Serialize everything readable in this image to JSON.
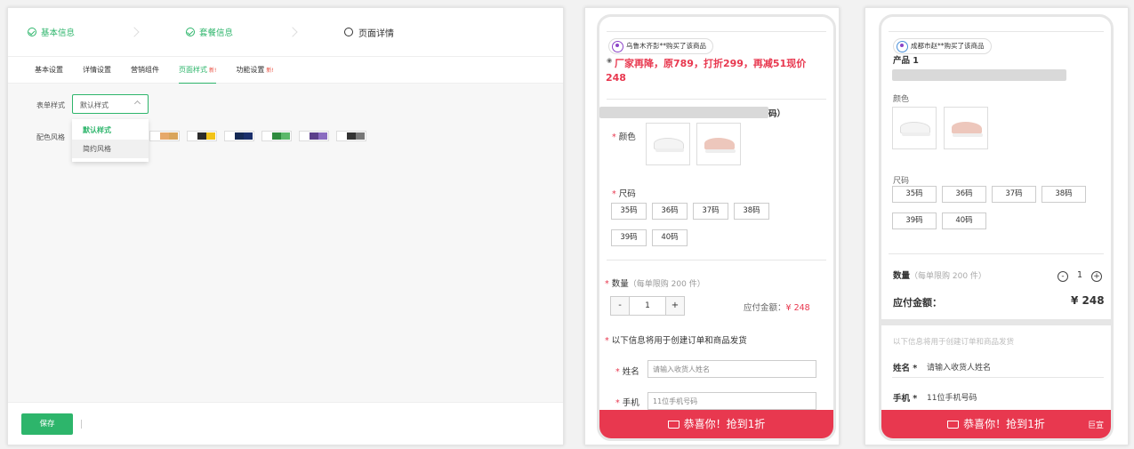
{
  "editor": {
    "steps": [
      {
        "label": "基本信息"
      },
      {
        "label": "套餐信息"
      },
      {
        "label": "页面详情"
      }
    ],
    "tabs": [
      {
        "label": "基本设置"
      },
      {
        "label": "详情设置"
      },
      {
        "label": "营销组件"
      },
      {
        "label": "页面样式",
        "badge": "新!"
      },
      {
        "label": "功能设置",
        "badge": "新!"
      }
    ],
    "form_style_label": "表单样式",
    "form_style_value": "默认样式",
    "form_style_options": [
      "默认样式",
      "简约风格"
    ],
    "color_label": "配色风格",
    "color_swatches": [
      [
        "#ffffff",
        "#e6a86a",
        "#d9a55c"
      ],
      [
        "#ffffff",
        "#2b2b2b",
        "#f2c318"
      ],
      [
        "#ffffff",
        "#152a55",
        "#1a2f6b"
      ],
      [
        "#ffffff",
        "#2e8b3e",
        "#5cb86a"
      ],
      [
        "#ffffff",
        "#5b3f8a",
        "#8a6cc0"
      ],
      [
        "#ffffff",
        "#333333",
        "#777777"
      ]
    ],
    "save_label": "保存",
    "accent": "#2db56b"
  },
  "phone1": {
    "toast": "乌鲁木齐彭**购买了该商品",
    "promo_line1": "厂家再降，原789，打折299，再减51现价",
    "promo_line2": "248",
    "title_tail": "码）",
    "color_label": "颜色",
    "size_label": "尺码",
    "sizes": [
      "35码",
      "36码",
      "37码",
      "38码",
      "39码",
      "40码"
    ],
    "qty_label": "数量",
    "qty_hint": "（每单限购 200 件）",
    "qty_minus": "-",
    "qty_value": "1",
    "qty_plus": "+",
    "pay_label": "应付金额：",
    "pay_value": "¥ 248",
    "info_note": "以下信息将用于创建订单和商品发货",
    "name_label": "姓名",
    "name_placeholder": "请输入收货人姓名",
    "phone_label": "手机",
    "phone_placeholder": "11位手机号码",
    "cta": "恭喜你！抢到1折"
  },
  "phone2": {
    "toast": "成都市赵**购买了该商品",
    "title_head": "产品 1",
    "color_label": "颜色",
    "size_label": "尺码",
    "sizes": [
      "35码",
      "36码",
      "37码",
      "38码",
      "39码",
      "40码"
    ],
    "qty_label": "数量",
    "qty_hint": "（每单限购 200 件）",
    "qty_minus": "-",
    "qty_value": "1",
    "qty_plus": "+",
    "pay_label": "应付金额：",
    "pay_value": "¥ 248",
    "info_note": "以下信息将用于创建订单和商品发货",
    "name_label": "姓名 *",
    "name_placeholder": "请输入收货人姓名",
    "phone_label": "手机 *",
    "phone_placeholder": "11位手机号码",
    "cta": "恭喜你！抢到1折",
    "brand": "巨宣"
  }
}
